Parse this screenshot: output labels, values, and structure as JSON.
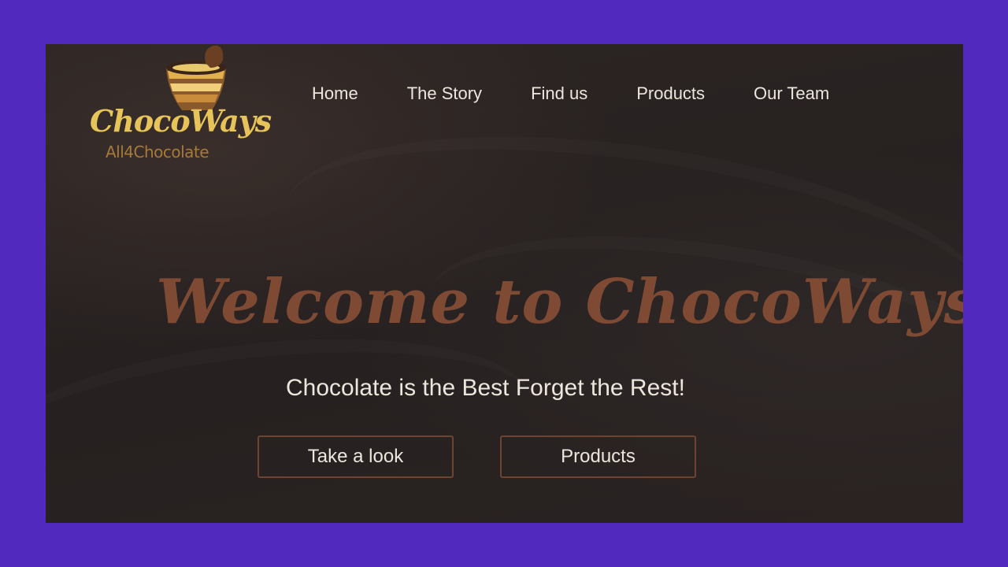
{
  "logo": {
    "name": "ChocoWays",
    "tagline": "All4Chocolate",
    "icon": "chocolate-cup-icon"
  },
  "nav": {
    "items": [
      {
        "label": "Home"
      },
      {
        "label": "The Story"
      },
      {
        "label": "Find us"
      },
      {
        "label": "Products"
      },
      {
        "label": "Our Team"
      }
    ]
  },
  "hero": {
    "title": "Welcome to ChocoWays",
    "tagline": "Chocolate is the Best Forget the Rest!",
    "primary_button": "Take a look",
    "secondary_button": "Products"
  },
  "colors": {
    "frame": "#5229bf",
    "background": "#262020",
    "logo_gold": "#e7c45a",
    "title_brown": "#7e4a33",
    "button_border": "#6e4330",
    "text": "#ece6dd"
  }
}
